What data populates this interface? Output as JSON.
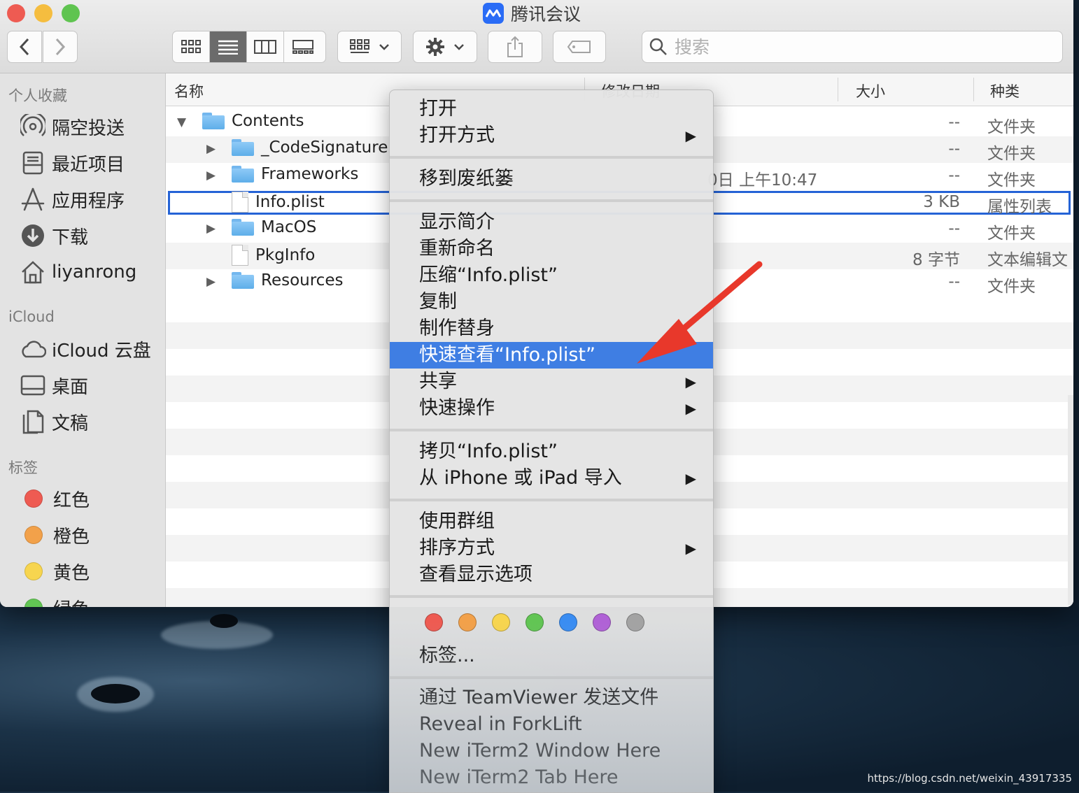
{
  "window": {
    "title": "腾讯会议"
  },
  "toolbar": {
    "search_placeholder": "搜索"
  },
  "sidebar": {
    "favorites_title": "个人收藏",
    "favorites": [
      {
        "label": "隔空投送",
        "icon": "airdrop-icon"
      },
      {
        "label": "最近项目",
        "icon": "recents-icon"
      },
      {
        "label": "应用程序",
        "icon": "applications-icon"
      },
      {
        "label": "下载",
        "icon": "download-icon"
      },
      {
        "label": "liyanrong",
        "icon": "home-icon"
      }
    ],
    "icloud_title": "iCloud",
    "icloud": [
      {
        "label": "iCloud 云盘",
        "icon": "cloud-icon"
      },
      {
        "label": "桌面",
        "icon": "desktop-icon"
      },
      {
        "label": "文稿",
        "icon": "documents-icon"
      }
    ],
    "tags_title": "标签",
    "tags": [
      {
        "label": "红色",
        "color": "#ee5b52"
      },
      {
        "label": "橙色",
        "color": "#f2a14a"
      },
      {
        "label": "黄色",
        "color": "#f7d54f"
      },
      {
        "label": "绿色",
        "color": "#62c554"
      }
    ]
  },
  "columns": {
    "name": "名称",
    "date": "修改日期",
    "size": "大小",
    "kind": "种类"
  },
  "files": [
    {
      "name": "Contents",
      "type": "folder",
      "expanded": true,
      "date": "",
      "size": "--",
      "kind": "文件夹"
    },
    {
      "name": "_CodeSignature",
      "type": "folder",
      "date": "",
      "size": "--",
      "kind": "文件夹"
    },
    {
      "name": "Frameworks",
      "type": "folder",
      "date": "0日 上午10:47",
      "size": "--",
      "kind": "文件夹"
    },
    {
      "name": "Info.plist",
      "type": "file",
      "selected": true,
      "date": "",
      "size": "3 KB",
      "kind": "属性列表"
    },
    {
      "name": "MacOS",
      "type": "folder",
      "date": "",
      "size": "--",
      "kind": "文件夹"
    },
    {
      "name": "PkgInfo",
      "type": "file",
      "date": "",
      "size": "8 字节",
      "kind": "文本编辑文"
    },
    {
      "name": "Resources",
      "type": "folder",
      "date": "",
      "size": "--",
      "kind": "文件夹"
    }
  ],
  "context_menu": {
    "items": [
      {
        "label": "打开"
      },
      {
        "label": "打开方式",
        "submenu": true
      },
      {
        "label": "移到废纸篓"
      },
      {
        "label": "显示简介"
      },
      {
        "label": "重新命名"
      },
      {
        "label": "压缩“Info.plist”"
      },
      {
        "label": "复制"
      },
      {
        "label": "制作替身"
      },
      {
        "label": "快速查看“Info.plist”",
        "highlighted": true
      },
      {
        "label": "共享",
        "submenu": true
      },
      {
        "label": "快速操作",
        "submenu": true
      },
      {
        "label": "拷贝“Info.plist”"
      },
      {
        "label": "从 iPhone 或 iPad 导入",
        "submenu": true
      },
      {
        "label": "使用群组"
      },
      {
        "label": "排序方式",
        "submenu": true
      },
      {
        "label": "查看显示选项"
      },
      {
        "label": "标签..."
      },
      {
        "label": "通过 TeamViewer 发送文件"
      },
      {
        "label": "Reveal in ForkLift"
      },
      {
        "label": "New iTerm2 Window Here"
      },
      {
        "label": "New iTerm2 Tab Here"
      }
    ],
    "tag_colors": [
      "#ee5b52",
      "#f2a14a",
      "#f7d54f",
      "#62c554",
      "#3a8df2",
      "#b062d6",
      "#a3a3a3"
    ],
    "submenu_glyph": "▶"
  },
  "watermark": "https://blog.csdn.net/weixin_43917335"
}
